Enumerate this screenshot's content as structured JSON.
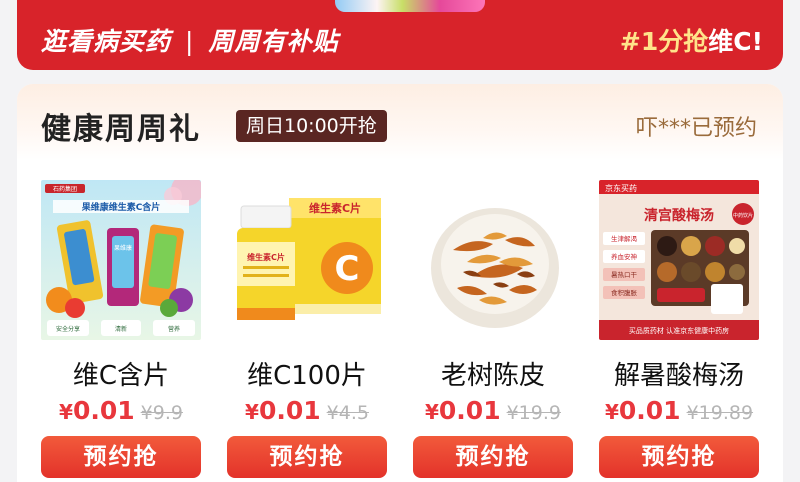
{
  "banner": {
    "left_text_1": "逛看病买药",
    "separator": "|",
    "left_text_2": "周周有补贴",
    "right_prefix": "#1分抢",
    "right_highlight": "维C!",
    "accent_color": "#d8232a"
  },
  "card": {
    "title": "健康周周礼",
    "badge": "周日10:00开抢",
    "reserved_status": "吓***已预约"
  },
  "products": [
    {
      "name": "维C含片",
      "currency": "¥",
      "price": "0.01",
      "original_price": "¥9.9",
      "button": "预约抢",
      "image": {
        "brand": "石药集团",
        "headline": "果维康维生素C含片",
        "pack": "果维康",
        "chips": [
          "安全分享",
          "清新",
          "营养"
        ]
      }
    },
    {
      "name": "维C100片",
      "currency": "¥",
      "price": "0.01",
      "original_price": "¥4.5",
      "button": "预约抢",
      "image": {
        "box_title": "维生素C片",
        "bottle_label": "维生素C片",
        "letter": "C"
      }
    },
    {
      "name": "老树陈皮",
      "currency": "¥",
      "price": "0.01",
      "original_price": "¥19.9",
      "button": "预约抢",
      "image": {}
    },
    {
      "name": "解暑酸梅汤",
      "currency": "¥",
      "price": "0.01",
      "original_price": "¥19.89",
      "button": "预约抢",
      "image": {
        "store": "京东买药",
        "headline": "清宫酸梅汤",
        "tags": [
          "生津解渴",
          "养血安神",
          "暑热口干",
          "食积腹胀"
        ],
        "seal": "中药饮片",
        "footer": "买品质药材 认准京东健康中药房"
      }
    }
  ]
}
